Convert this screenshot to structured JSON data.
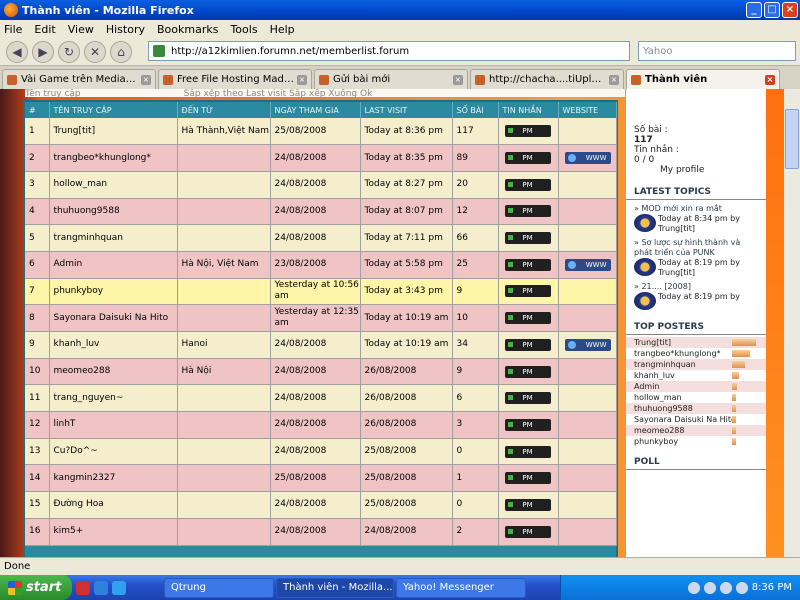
{
  "window": {
    "title": "Thành viên - Mozilla Firefox"
  },
  "menu": [
    "File",
    "Edit",
    "View",
    "History",
    "Bookmarks",
    "Tools",
    "Help"
  ],
  "nav": {
    "url": "http://a12kimlien.forumn.net/memberlist.forum",
    "search_placeholder": "Yahoo"
  },
  "tabs": [
    {
      "label": "Vài Game trên MediaFire - Ga...",
      "active": false
    },
    {
      "label": "Free File Hosting Made Simpl...",
      "active": false
    },
    {
      "label": "Gửi bài mới",
      "active": false
    },
    {
      "label": "http://chacha....tiUploadResult",
      "active": false
    },
    {
      "label": "Thành viên",
      "active": true
    }
  ],
  "top_strip": {
    "left": "Tên truy cập",
    "mid": "Sắp xếp theo",
    "sort": "Last visit",
    "order_label": "Sắp xếp",
    "order": "Xuống",
    "ok": "Ok"
  },
  "table": {
    "headers": [
      "#",
      "TÊN TRUY CẬP",
      "ĐẾN TỪ",
      "NGÀY THAM GIA",
      "LAST VISIT",
      "SỐ BÀI",
      "TIN NHẮN",
      "WEBSITE"
    ],
    "rows": [
      {
        "n": "1",
        "name": "Trung[tit]",
        "from": "Hà Thành,Việt Nam",
        "joined": "25/08/2008",
        "last": "Today at 8:36 pm",
        "posts": "117",
        "pm": "PM",
        "www": ""
      },
      {
        "n": "2",
        "name": "trangbeo*khunglong*",
        "from": "",
        "joined": "24/08/2008",
        "last": "Today at 8:35 pm",
        "posts": "89",
        "pm": "PM",
        "www": "WWW"
      },
      {
        "n": "3",
        "name": "hollow_man",
        "from": "",
        "joined": "24/08/2008",
        "last": "Today at 8:27 pm",
        "posts": "20",
        "pm": "PM",
        "www": ""
      },
      {
        "n": "4",
        "name": "thuhuong9588",
        "from": "",
        "joined": "24/08/2008",
        "last": "Today at 8:07 pm",
        "posts": "12",
        "pm": "PM",
        "www": ""
      },
      {
        "n": "5",
        "name": "trangminhquan",
        "from": "",
        "joined": "24/08/2008",
        "last": "Today at 7:11 pm",
        "posts": "66",
        "pm": "PM",
        "www": ""
      },
      {
        "n": "6",
        "name": "Admin",
        "from": "Hà Nội, Việt Nam",
        "joined": "23/08/2008",
        "last": "Today at 5:58 pm",
        "posts": "25",
        "pm": "PM",
        "www": "WWW"
      },
      {
        "n": "7",
        "name": "phunkyboy",
        "from": "",
        "joined": "Yesterday at 10:56 am",
        "last": "Today at 3:43 pm",
        "posts": "9",
        "pm": "PM",
        "www": ""
      },
      {
        "n": "8",
        "name": "Sayonara Daisuki Na Hito",
        "from": "",
        "joined": "Yesterday at 12:35 am",
        "last": "Today at 10:19 am",
        "posts": "10",
        "pm": "PM",
        "www": ""
      },
      {
        "n": "9",
        "name": "khanh_luv",
        "from": "Hanoi",
        "joined": "24/08/2008",
        "last": "Today at 10:19 am",
        "posts": "34",
        "pm": "PM",
        "www": "WWW"
      },
      {
        "n": "10",
        "name": "meomeo288",
        "from": "Hà Nội",
        "joined": "24/08/2008",
        "last": "26/08/2008",
        "posts": "9",
        "pm": "PM",
        "www": ""
      },
      {
        "n": "11",
        "name": "trang_nguyen~",
        "from": "",
        "joined": "24/08/2008",
        "last": "26/08/2008",
        "posts": "6",
        "pm": "PM",
        "www": ""
      },
      {
        "n": "12",
        "name": "linhT",
        "from": "",
        "joined": "24/08/2008",
        "last": "26/08/2008",
        "posts": "3",
        "pm": "PM",
        "www": ""
      },
      {
        "n": "13",
        "name": "Cu?Do^~",
        "from": "",
        "joined": "24/08/2008",
        "last": "25/08/2008",
        "posts": "0",
        "pm": "PM",
        "www": ""
      },
      {
        "n": "14",
        "name": "kangmin2327",
        "from": "",
        "joined": "25/08/2008",
        "last": "25/08/2008",
        "posts": "1",
        "pm": "PM",
        "www": ""
      },
      {
        "n": "15",
        "name": "Đường Hoa",
        "from": "",
        "joined": "24/08/2008",
        "last": "25/08/2008",
        "posts": "0",
        "pm": "PM",
        "www": ""
      },
      {
        "n": "16",
        "name": "kim5+",
        "from": "",
        "joined": "24/08/2008",
        "last": "24/08/2008",
        "posts": "2",
        "pm": "PM",
        "www": ""
      }
    ]
  },
  "sidebar": {
    "posts_label": "Số bài :",
    "posts_value": "117",
    "msgs_label": "Tin nhắn :",
    "msgs_value": "0 / 0",
    "profile": "My profile",
    "latest_title": "LATEST TOPICS",
    "topics": [
      {
        "title": "» MOD mới xin ra mắt",
        "meta": "Today at 8:34 pm by Trung[tit]"
      },
      {
        "title": "» Sơ lược sự hình thành và phát triển của PUNK",
        "meta": "Today at 8:19 pm by Trung[tit]"
      },
      {
        "title": "» 21.... [2008]",
        "meta": "Today at 8:19 pm by"
      }
    ],
    "posters_title": "TOP POSTERS",
    "posters": [
      {
        "name": "Trung[tit]",
        "level": 1.0
      },
      {
        "name": "trangbeo*khunglong*",
        "level": 0.76
      },
      {
        "name": "trangminhquan",
        "level": 0.56
      },
      {
        "name": "khanh_luv",
        "level": 0.29
      },
      {
        "name": "Admin",
        "level": 0.21
      },
      {
        "name": "hollow_man",
        "level": 0.17
      },
      {
        "name": "thuhuong9588",
        "level": 0.1
      },
      {
        "name": "Sayonara Daisuki Na Hito",
        "level": 0.09
      },
      {
        "name": "meomeo288",
        "level": 0.08
      },
      {
        "name": "phunkyboy",
        "level": 0.08
      }
    ],
    "poll_title": "POLL"
  },
  "status": "Done",
  "taskbar": {
    "start": "start",
    "buttons": [
      {
        "label": "Qtrung",
        "active": false
      },
      {
        "label": "Thành viên - Mozilla...",
        "active": true
      },
      {
        "label": "Yahoo! Messenger",
        "active": false
      }
    ],
    "clock": "8:36 PM"
  }
}
